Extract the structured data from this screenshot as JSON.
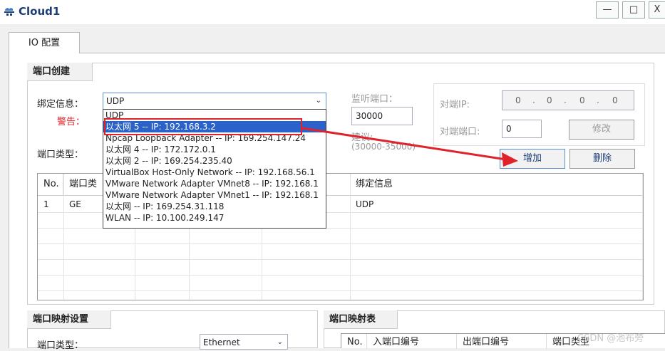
{
  "window": {
    "title": "Cloud1",
    "minimize": "—",
    "maximize": "□",
    "close": "X"
  },
  "tabs": [
    {
      "label": "IO 配置"
    }
  ],
  "port_create": {
    "section_title": "端口创建",
    "bind_label": "绑定信息：",
    "bind_value": "UDP",
    "warning_label": "警告：",
    "port_type_label": "端口类型：",
    "listen_port_label": "监听端口：",
    "listen_port_value": "30000",
    "suggest_label": "建议:",
    "suggest_range": "(30000-35000)",
    "peer_ip_label": "对端IP:",
    "peer_ip_octets": [
      "0",
      "0",
      "0",
      "0"
    ],
    "peer_port_label": "对端端口:",
    "peer_port_value": "0",
    "modify_button": "修改",
    "add_button": "增加",
    "delete_button": "删除"
  },
  "dropdown": {
    "options": [
      "UDP",
      "以太网 5 -- IP: 192.168.3.2",
      "Npcap Loopback Adapter -- IP: 169.254.147.24",
      "以太网 4 -- IP: 172.172.0.1",
      "以太网 2 -- IP: 169.254.235.40",
      "VirtualBox Host-Only Network -- IP: 192.168.56.1",
      "VMware Network Adapter VMnet8 -- IP: 192.168.1",
      "VMware Network Adapter VMnet1 -- IP: 192.168.1",
      "以太网 -- IP: 169.254.31.118",
      "WLAN -- IP: 10.100.249.147"
    ],
    "selected_index": 1
  },
  "port_table": {
    "headers": {
      "no": "No.",
      "type": "端口类",
      "bind": "绑定信息"
    },
    "rows": [
      {
        "no": "1",
        "type": "GE",
        "bind": "UDP"
      }
    ]
  },
  "port_mapping": {
    "section_title": "端口映射设置",
    "port_type_label": "端口类型：",
    "port_type_value": "Ethernet"
  },
  "mapping_table": {
    "section_title": "端口映射表",
    "headers": [
      "No.",
      "入端口编号",
      "出端口编号",
      "端口类型"
    ]
  },
  "watermark": "CSDN @池布旁",
  "colors": {
    "accent": "#2a62c9",
    "annotation_red": "#e0232a",
    "warning": "#e0232a"
  }
}
